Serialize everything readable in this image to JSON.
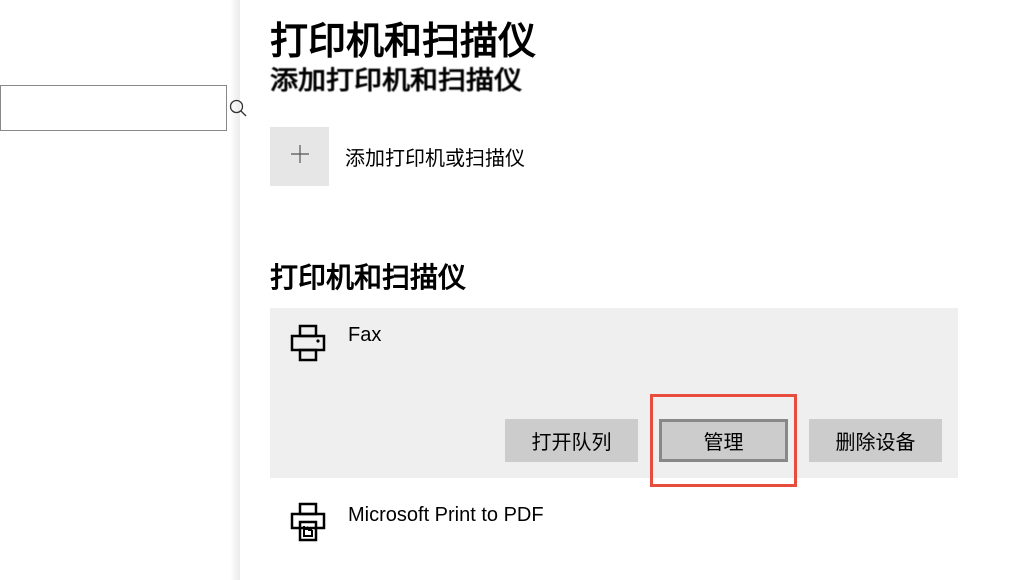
{
  "sidebar": {
    "search_placeholder": ""
  },
  "content": {
    "page_title": "打印机和扫描仪",
    "obscured_subtitle": "添加打印机和扫描仪",
    "add_printer_label": "添加打印机或扫描仪",
    "list_header": "打印机和扫描仪",
    "printers": [
      {
        "name": "Fax"
      },
      {
        "name": "Microsoft Print to PDF"
      }
    ],
    "buttons": {
      "open_queue": "打开队列",
      "manage": "管理",
      "remove": "删除设备"
    }
  }
}
